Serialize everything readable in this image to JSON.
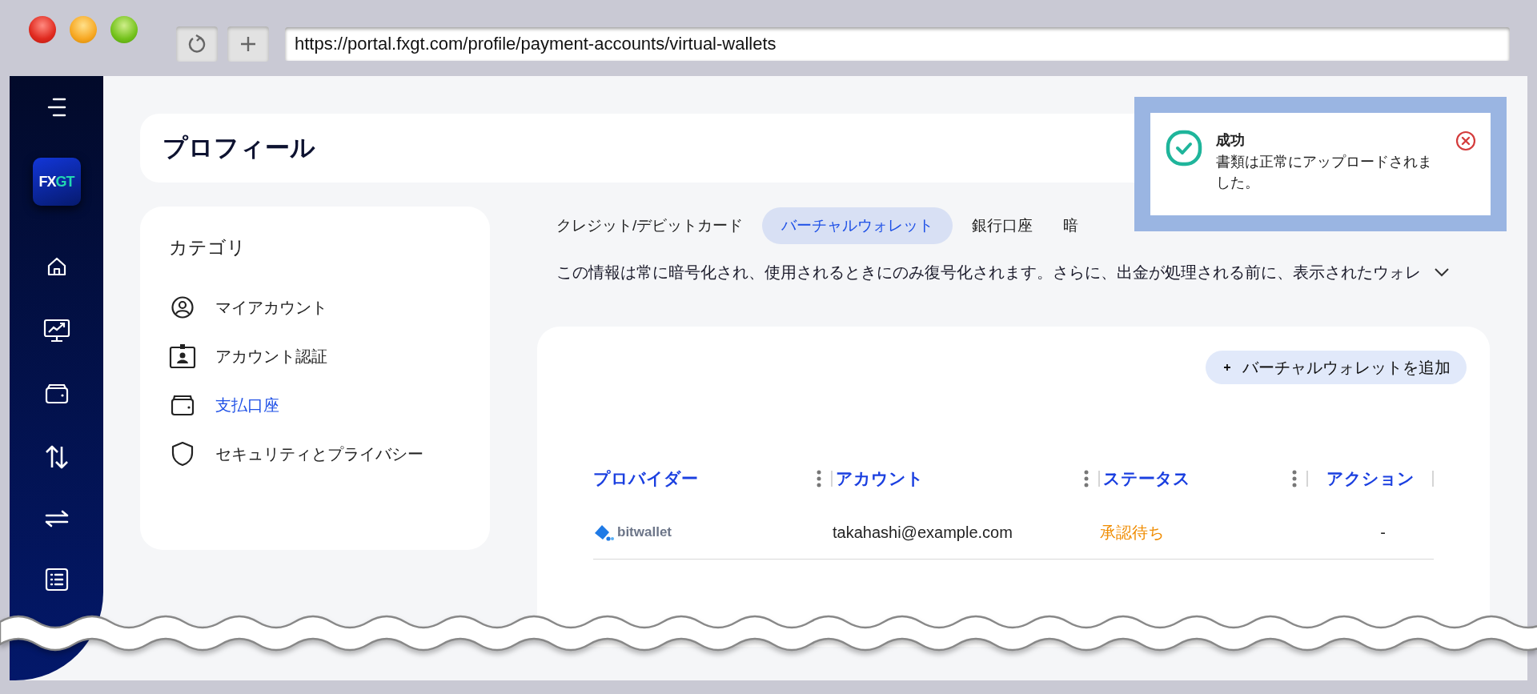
{
  "browser": {
    "url": "https://portal.fxgt.com/profile/payment-accounts/virtual-wallets"
  },
  "logo": {
    "parts": [
      "FX",
      "GT"
    ]
  },
  "page_title": "プロフィール",
  "categories": {
    "title": "カテゴリ",
    "items": [
      {
        "label": "マイアカウント",
        "selected": false
      },
      {
        "label": "アカウント認証",
        "selected": false
      },
      {
        "label": "支払口座",
        "selected": true
      },
      {
        "label": "セキュリティとプライバシー",
        "selected": false
      }
    ]
  },
  "tabs": [
    {
      "label": "クレジット/デビットカード",
      "selected": false
    },
    {
      "label": "バーチャルウォレット",
      "selected": true
    },
    {
      "label": "銀行口座",
      "selected": false
    },
    {
      "label": "暗",
      "selected": false
    }
  ],
  "info": {
    "text": "この情報は常に暗号化され、使用されるときにのみ復号化されます。さらに、出金が処理される前に、表示されたウォレ",
    "expanded": false
  },
  "add_button": "バーチャルウォレットを追加",
  "table": {
    "columns": [
      "プロバイダー",
      "アカウント",
      "ステータス",
      "アクション"
    ],
    "rows": [
      {
        "provider": "bitwallet",
        "account": "takahashi@example.com",
        "status": {
          "text": "承認待ち",
          "kind": "pending"
        },
        "action": "-"
      }
    ]
  },
  "toast": {
    "kind": "success",
    "title": "成功",
    "message": "書類は正常にアップロードされました。"
  }
}
